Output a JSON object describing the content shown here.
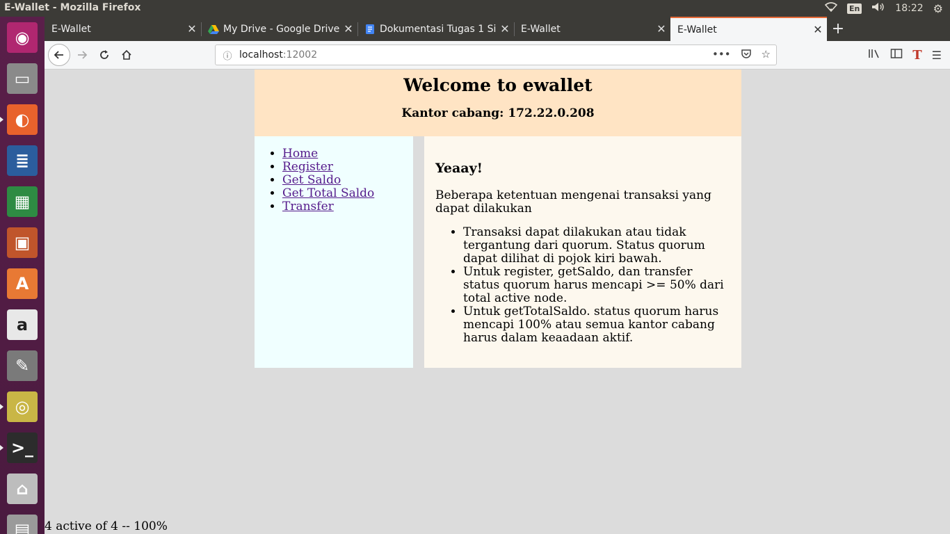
{
  "system": {
    "window_title": "E-Wallet - Mozilla Firefox",
    "language": "En",
    "clock": "18:22"
  },
  "launcher": {
    "items": [
      {
        "name": "ubuntu-dash",
        "glyph": "◉",
        "color": "#b02770"
      },
      {
        "name": "files",
        "glyph": "▭",
        "color": "#8a8a8a"
      },
      {
        "name": "firefox",
        "glyph": "◐",
        "color": "#e8622c"
      },
      {
        "name": "writer",
        "glyph": "≣",
        "color": "#2b5d9d"
      },
      {
        "name": "calc",
        "glyph": "▦",
        "color": "#2e8b43"
      },
      {
        "name": "impress",
        "glyph": "▣",
        "color": "#c0552b"
      },
      {
        "name": "software",
        "glyph": "A",
        "color": "#e87934"
      },
      {
        "name": "amazon",
        "glyph": "a",
        "color": "#e8e8e8"
      },
      {
        "name": "settings",
        "glyph": "✎",
        "color": "#7a7a7a"
      },
      {
        "name": "rhythmbox",
        "glyph": "◎",
        "color": "#c9b646"
      },
      {
        "name": "terminal",
        "glyph": ">_",
        "color": "#2c2c2c"
      },
      {
        "name": "disks",
        "glyph": "⌂",
        "color": "#bdbdbd"
      },
      {
        "name": "trash",
        "glyph": "▤",
        "color": "#9a9a9a"
      }
    ]
  },
  "browser": {
    "tabs": [
      {
        "label": "E-Wallet",
        "active": false,
        "favicon": ""
      },
      {
        "label": "My Drive - Google Drive",
        "active": false,
        "favicon": "drive-icon"
      },
      {
        "label": "Dokumentasi Tugas 1 Si",
        "active": false,
        "favicon": "docs-icon"
      },
      {
        "label": "E-Wallet",
        "active": false,
        "favicon": ""
      },
      {
        "label": "E-Wallet",
        "active": true,
        "favicon": ""
      }
    ],
    "url_host": "localhost",
    "url_port": ":12002"
  },
  "page": {
    "title": "Welcome to ewallet",
    "branch": "Kantor cabang: 172.22.0.208",
    "nav": [
      "Home",
      "Register",
      "Get Saldo",
      "Get Total Saldo",
      "Transfer"
    ],
    "heading": "Yeaay!",
    "intro": "Beberapa ketentuan mengenai transaksi yang dapat dilakukan",
    "rules": [
      "Transaksi dapat dilakukan atau tidak tergantung dari quorum. Status quorum dapat dilihat di pojok kiri bawah.",
      "Untuk register, getSaldo, dan transfer status quorum harus mencapi >= 50% dari total active node.",
      "Untuk getTotalSaldo. status quorum harus mencapi 100% atau semua kantor cabang harus dalam keaadaan aktif."
    ],
    "quorum_status": "4 active of 4 -- 100%"
  },
  "colors": {
    "header_bg": "#ffe4c4",
    "sidebar_bg": "#f0ffff",
    "content_bg": "#fdf8ee",
    "link": "#551a8b",
    "active_tab_accent": "#e66a38"
  }
}
